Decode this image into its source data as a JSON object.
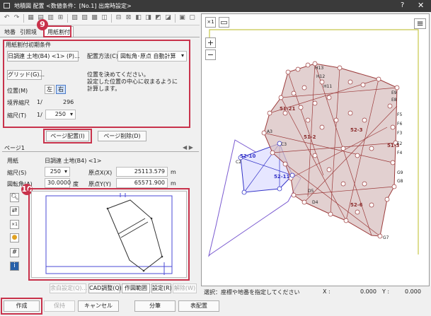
{
  "titlebar": {
    "title": "地積図 配置  <数値条件：[No.1] 出席時設定>",
    "help": "?",
    "close": "✕"
  },
  "tabs": [
    "地番",
    "引照境",
    "用紙割付"
  ],
  "badges": {
    "b9": "9",
    "b10": "10"
  },
  "initial": {
    "section_title": "用紙割付初期条件",
    "paper": "日調連 土地(B4) <1> (P)...",
    "method_label": "配置方法(C)",
    "method_value": "図転角･原点 自動計算",
    "grid_button": "グリッド(G)...",
    "position_label": "位置(M)",
    "pos_left": "左",
    "pos_right": "右",
    "boundary_scale_label": "境界縮尺",
    "boundary_scale_prefix": "1/",
    "boundary_scale_value": "296",
    "scale_label": "縮尺(T)",
    "scale_prefix": "1/",
    "scale_value": "250",
    "note_line1": "位置を決めてください。",
    "note_line2": "設定した位置の中心に収まるように",
    "note_line3": "計算します。"
  },
  "page_buttons": {
    "place": "ページ配置(I)",
    "delete": "ページ削除(D)"
  },
  "page_section": {
    "tab": "ページ1",
    "paper_label": "用紙",
    "paper_value": "日調連 土地(B4) <1>",
    "scale_label": "縮尺(S)",
    "scale_value": "250",
    "originx_label": "原点X(X)",
    "originx_value": "25113.579",
    "originx_unit": "m",
    "rotation_label": "図転角(A)",
    "rotation_value": "30.0000",
    "rotation_unit": "度",
    "originy_label": "原点Y(Y)",
    "originy_value": "65571.900",
    "originy_unit": "m"
  },
  "side_icons": [
    "search-icon",
    "transfer-icon",
    "scale-x1-icon",
    "bulb-icon",
    "grid-icon",
    "info-icon"
  ],
  "preview_buttons": [
    "余白設定(Q)...",
    "CAD調整(Q)",
    "作図範囲",
    "設定(R)",
    "解除(W)"
  ],
  "map": {
    "x1": "×1",
    "plus": "+",
    "minus": "−",
    "labels": [
      "51-21",
      "51-2",
      "52-3",
      "51-3",
      "52-10",
      "52-11",
      "52-6",
      "A3",
      "C2",
      "C3",
      "D4",
      "D5",
      "E8",
      "E9",
      "F2",
      "F3",
      "F4",
      "F5",
      "F6",
      "G7",
      "G8",
      "G9",
      "H11",
      "H12",
      "H13"
    ]
  },
  "status": {
    "text": "選択：座標や地番を指定してください",
    "x_label": "X :",
    "x_value": "0.000",
    "y_label": "Y :",
    "y_value": "0.000"
  },
  "bottom": {
    "create": "作成",
    "keep": "保持",
    "cancel": "キャンセル",
    "split": "分筆",
    "arrange": "表配置"
  },
  "colors": {
    "accent": "#c8324b",
    "parcel": "#9c3b3b",
    "page": "#4a4ad6",
    "paper": "#c8c84a"
  }
}
